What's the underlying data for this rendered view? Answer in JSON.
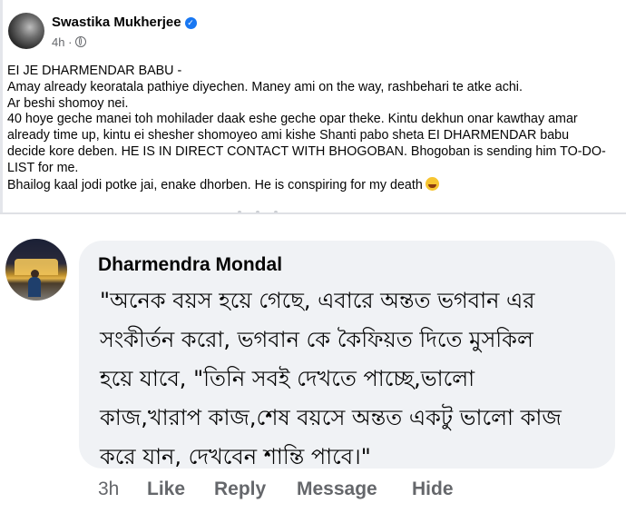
{
  "post": {
    "author": "Swastika Mukherjee",
    "time": "4h",
    "lines": [
      "EI JE DHARMENDAR BABU -",
      "Amay already keoratala pathiye diyechen. Maney ami on the way, rashbehari te atke achi.",
      "Ar beshi shomoy nei.",
      "40 hoye geche manei toh mohilader daak eshe geche opar theke. Kintu dekhun onar kawthay amar",
      "already time up, kintu ei shesher shomoyeo ami kishe Shanti pabo sheta EI DHARMENDAR babu",
      "decide kore deben. HE IS IN DIRECT CONTACT WITH BHOGOBAN. Bhogoban is sending him TO-DO-",
      "LIST for me.",
      "Bhailog kaal jodi potke jai, enake dhorben. He is conspiring for my death"
    ],
    "emoji_icon": "rolling-laughing-emoji-icon"
  },
  "comment": {
    "author": "Dharmendra Mondal",
    "lines": [
      "\"অনেক বয়স হয়ে গেছে, এবারে অন্তত ভগবান এর",
      "সংকীর্তন করো, ভগবান কে কৈফিয়ত দিতে মুসকিল",
      "হয়ে যাবে, \"তিনি সবই দেখতে পাচ্ছে,ভালো",
      "কাজ,খারাপ কাজ,শেষ বয়সে অন্তত একটু ভালো কাজ",
      "করে যান, দেখবেন শান্তি পাবে।\""
    ],
    "actions": {
      "time": "3h",
      "like": "Like",
      "reply": "Reply",
      "message": "Message",
      "hide": "Hide"
    }
  },
  "colors": {
    "verified_badge": "#1877f2",
    "meta_text": "#65676b",
    "bubble_bg": "#f0f2f5"
  }
}
